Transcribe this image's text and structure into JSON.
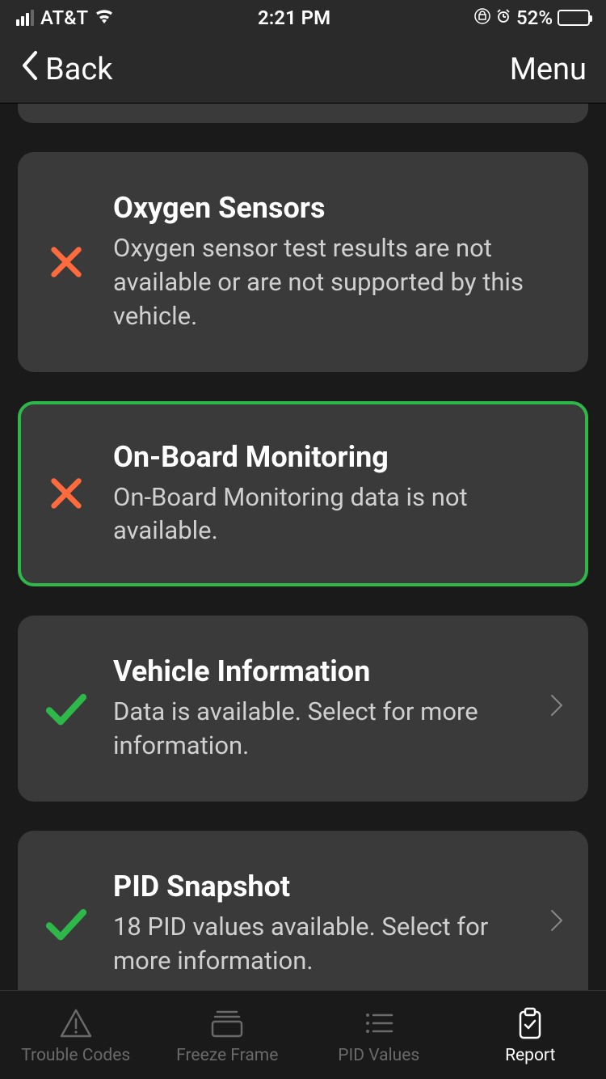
{
  "status": {
    "carrier": "AT&T",
    "time": "2:21 PM",
    "battery": "52%"
  },
  "nav": {
    "back": "Back",
    "menu": "Menu"
  },
  "cards": [
    {
      "title": "Oxygen Sensors",
      "desc": "Oxygen sensor test results are not available or are not supported by this vehicle.",
      "status": "fail",
      "chevron": false,
      "highlighted": false
    },
    {
      "title": "On-Board Monitoring",
      "desc": "On-Board Monitoring data is not available.",
      "status": "fail",
      "chevron": false,
      "highlighted": true
    },
    {
      "title": "Vehicle Information",
      "desc": "Data is available. Select for more information.",
      "status": "pass",
      "chevron": true,
      "highlighted": false
    },
    {
      "title": "PID Snapshot",
      "desc": "18 PID values available. Select for more information.",
      "status": "pass",
      "chevron": true,
      "highlighted": false
    }
  ],
  "tabs": [
    {
      "label": "Trouble Codes",
      "active": false
    },
    {
      "label": "Freeze Frame",
      "active": false
    },
    {
      "label": "PID Values",
      "active": false
    },
    {
      "label": "Report",
      "active": true
    }
  ],
  "colors": {
    "fail": "#ff6b3d",
    "pass": "#2fb84a",
    "highlight": "#2fb84a"
  }
}
